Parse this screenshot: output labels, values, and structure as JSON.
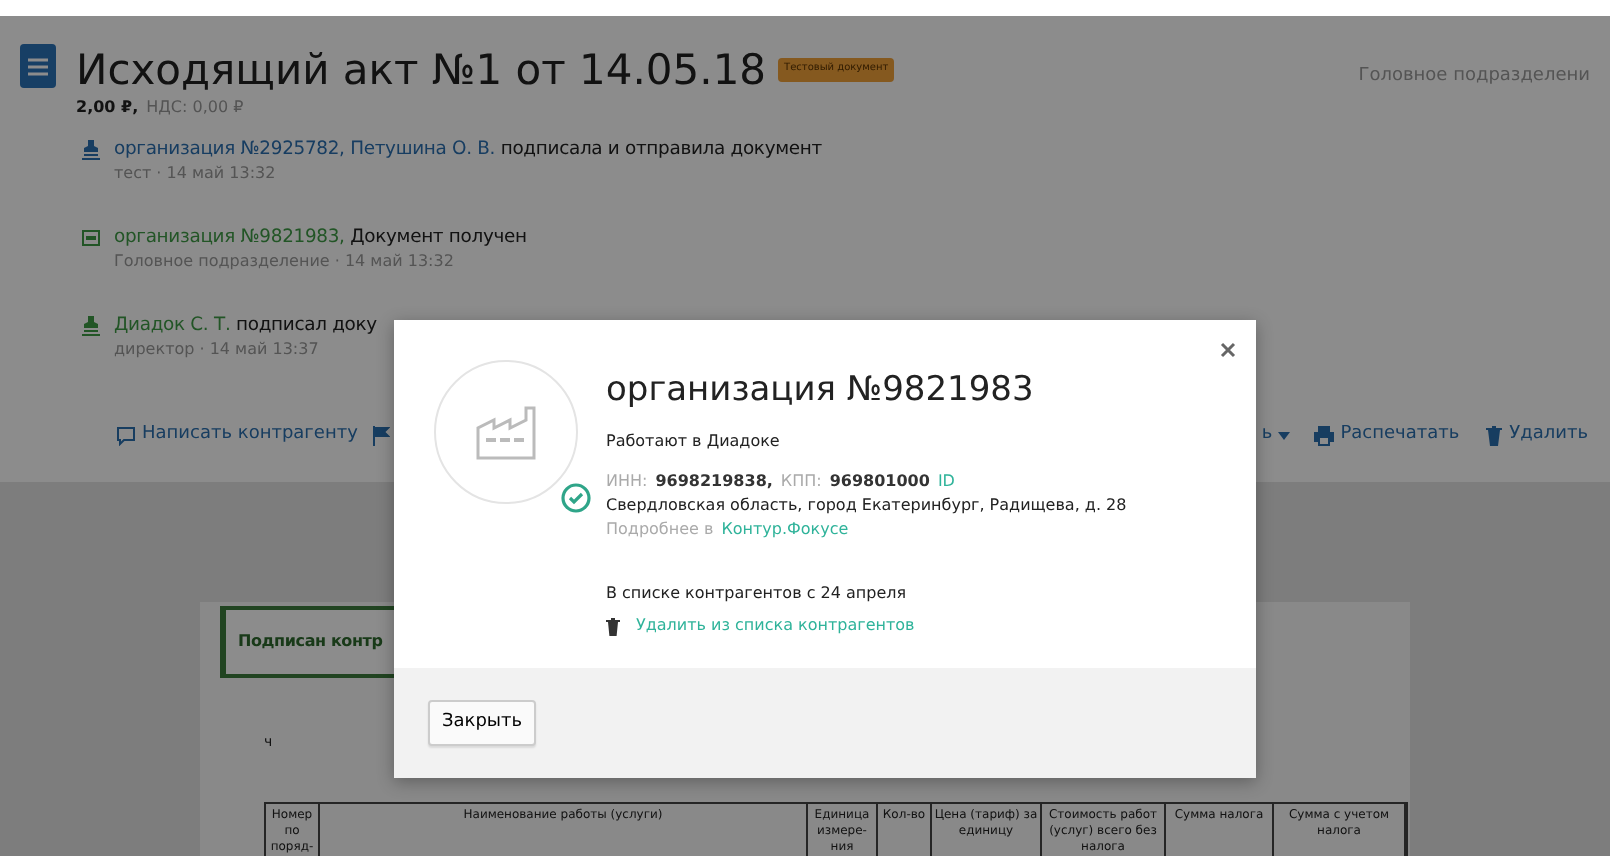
{
  "header": {
    "title": "Исходящий акт №1 от 14.05.18",
    "badge": "Тестовый документ",
    "amount": "2,00 ₽,",
    "vat": "НДС: 0,00 ₽",
    "division": "Головное подразделени"
  },
  "events": [
    {
      "kind": "signer",
      "color": "#173d61",
      "link": "организация №2925782, Петушина О. В.",
      "text": "подписала и отправила документ",
      "meta": "тест · 14 май 13:32"
    },
    {
      "kind": "received",
      "color": "#225526",
      "link": "организация №9821983,",
      "text": "Документ получен",
      "meta": "Головное подразделение · 14 май 13:32"
    },
    {
      "kind": "signer",
      "color": "#225526",
      "link": "Диадок С. Т.",
      "text": "подписал доку",
      "meta": "директор · 14 май 13:37"
    }
  ],
  "actions": [
    {
      "kind": "comment",
      "label": "Написать контрагенту"
    },
    {
      "kind": "flag"
    },
    {
      "kind": "dropdown",
      "label": "ь"
    },
    {
      "kind": "print",
      "label": "Распечатать"
    },
    {
      "kind": "trash",
      "label": "Удалить"
    }
  ],
  "document": {
    "stamp": "Подписан контр",
    "fragment": "ч",
    "columns": [
      "Номер по поряд-",
      "Наименование работы (услуги)",
      "Единица измере-ния",
      "Кол-во",
      "Цена (тариф) за единицу",
      "Стоимость работ (услуг) всего без налога",
      "Сумма налога",
      "Сумма с учетом налога"
    ]
  },
  "modal": {
    "title": "организация №9821983",
    "verified": true,
    "status": "Работают в Диадоке",
    "inn_label": "ИНН:",
    "inn": "9698219838,",
    "kpp_label": "КПП:",
    "kpp": "969801000",
    "id_link": "ID",
    "address": "Свердловская область, город Екатеринбург, Радищева, д. 28",
    "more_prefix": "Подробнее в",
    "more_link": "Контур.Фокусе",
    "since": "В списке контрагентов с 24 апреля",
    "remove_link": "Удалить из списка контрагентов",
    "close_button": "Закрыть"
  }
}
